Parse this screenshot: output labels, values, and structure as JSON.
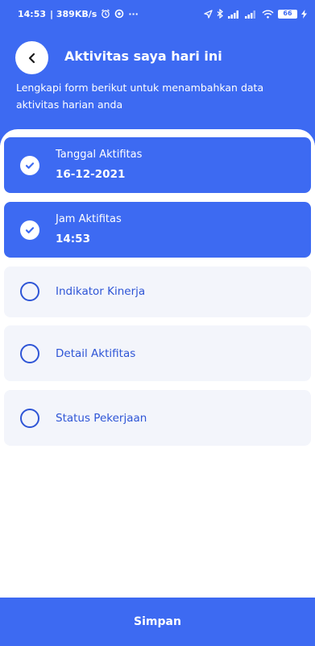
{
  "status_bar": {
    "time": "14:53",
    "net_speed": "| 389KB/s",
    "more": "···",
    "battery_level": "66"
  },
  "header": {
    "title": "Aktivitas saya hari ini",
    "subtitle": "Lengkapi form berikut untuk menambahkan data aktivitas harian anda"
  },
  "steps": [
    {
      "label": "Tanggal Aktifitas",
      "value": "16-12-2021",
      "done": true
    },
    {
      "label": "Jam Aktifitas",
      "value": "14:53",
      "done": true
    },
    {
      "label": "Indikator Kinerja",
      "done": false
    },
    {
      "label": "Detail Aktifitas",
      "done": false
    },
    {
      "label": "Status Pekerjaan",
      "done": false
    }
  ],
  "footer": {
    "save_label": "Simpan"
  },
  "colors": {
    "primary": "#3d6af2",
    "card_inactive": "#f3f5fb",
    "link_blue": "#2e55d6"
  }
}
